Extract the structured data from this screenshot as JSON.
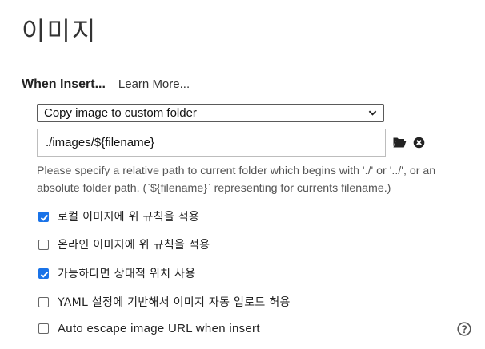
{
  "page": {
    "title": "이미지"
  },
  "insert": {
    "label": "When Insert...",
    "learn_more": "Learn More..."
  },
  "select": {
    "value": "Copy image to custom folder"
  },
  "path": {
    "value": "./images/${filename}"
  },
  "hint": "Please specify a relative path to current folder which begins with './' or '../', or an absolute folder path. (`${filename}` representing for currents filename.)",
  "options": [
    {
      "label": "로컬 이미지에 위 규칙을 적용",
      "checked": true
    },
    {
      "label": "온라인 이미지에 위 규칙을 적용",
      "checked": false
    },
    {
      "label": "가능하다면 상대적 위치 사용",
      "checked": true
    },
    {
      "label": "YAML 설정에 기반해서 이미지 자동 업로드 허용",
      "checked": false
    },
    {
      "label": "Auto escape image URL when insert",
      "checked": false
    }
  ],
  "icons": {
    "folder": "folder-icon",
    "clear": "clear-icon",
    "help": "help-icon",
    "chevron": "chevron-down-icon"
  },
  "colors": {
    "checkbox_accent": "#1a73e8"
  }
}
